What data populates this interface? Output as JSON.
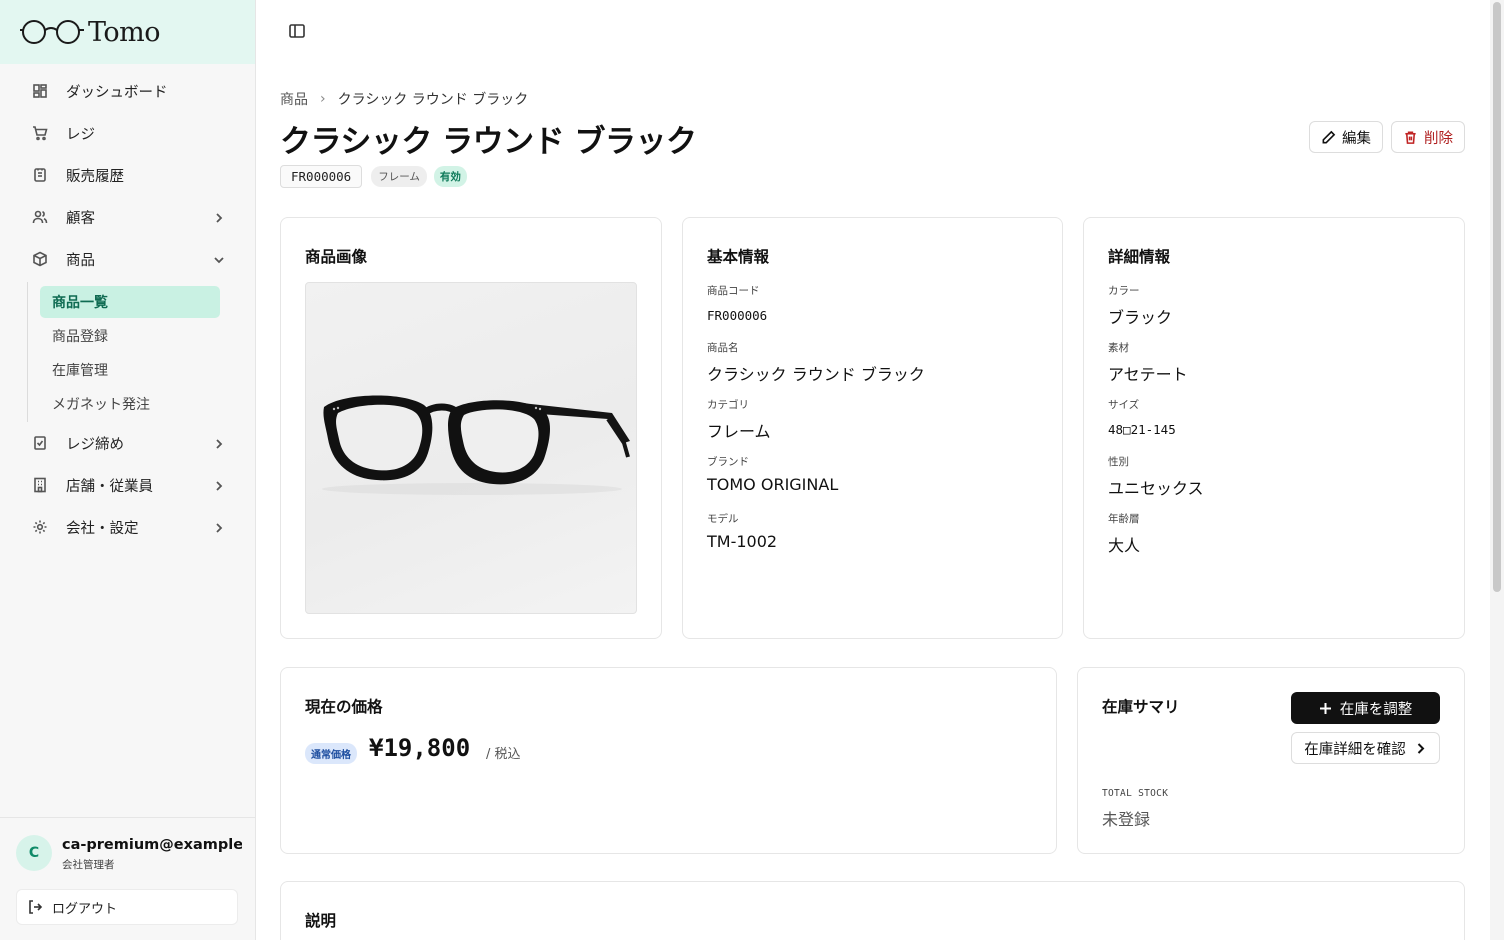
{
  "brand": {
    "name": "Tomo"
  },
  "sidebar": {
    "items": [
      {
        "label": "ダッシュボード",
        "icon": "dashboard-icon"
      },
      {
        "label": "レジ",
        "icon": "cart-icon"
      },
      {
        "label": "販売履歴",
        "icon": "receipt-icon"
      },
      {
        "label": "顧客",
        "icon": "users-icon"
      },
      {
        "label": "商品",
        "icon": "package-icon"
      },
      {
        "label": "レジ締め",
        "icon": "register-close-icon"
      },
      {
        "label": "店舗・従業員",
        "icon": "building-icon"
      },
      {
        "label": "会社・設定",
        "icon": "gear-icon"
      }
    ],
    "sub_items": [
      {
        "label": "商品一覧",
        "active": true
      },
      {
        "label": "商品登録"
      },
      {
        "label": "在庫管理"
      },
      {
        "label": "メガネット発注"
      }
    ]
  },
  "user": {
    "avatar_letter": "C",
    "email": "ca-premium@example.com",
    "role": "会社管理者",
    "logout_label": "ログアウト"
  },
  "breadcrumb": {
    "parent": "商品",
    "current": "クラシック ラウンド ブラック"
  },
  "product": {
    "title": "クラシック ラウンド ブラック",
    "code": "FR000006",
    "category_tag": "フレーム",
    "status_tag": "有効"
  },
  "actions": {
    "edit_label": "編集",
    "delete_label": "削除"
  },
  "image_card": {
    "title": "商品画像"
  },
  "basic_info": {
    "title": "基本情報",
    "fields": [
      {
        "label": "商品コード",
        "value": "FR000006"
      },
      {
        "label": "商品名",
        "value": "クラシック ラウンド ブラック"
      },
      {
        "label": "カテゴリ",
        "value": "フレーム"
      },
      {
        "label": "ブランド",
        "value": "TOMO ORIGINAL"
      },
      {
        "label": "モデル",
        "value": "TM-1002"
      }
    ]
  },
  "detail_info": {
    "title": "詳細情報",
    "fields": [
      {
        "label": "カラー",
        "value": "ブラック"
      },
      {
        "label": "素材",
        "value": "アセテート"
      },
      {
        "label": "サイズ",
        "value": "48□21-145"
      },
      {
        "label": "性別",
        "value": "ユニセックス"
      },
      {
        "label": "年齢層",
        "value": "大人"
      }
    ]
  },
  "price": {
    "title": "現在の価格",
    "badge": "通常価格",
    "amount": "¥19,800",
    "unit": "/ 税込"
  },
  "stock": {
    "title": "在庫サマリ",
    "adjust_label": "在庫を調整",
    "detail_label": "在庫詳細を確認",
    "total_label": "TOTAL STOCK",
    "total_value": "未登録"
  },
  "description": {
    "title": "説明"
  }
}
